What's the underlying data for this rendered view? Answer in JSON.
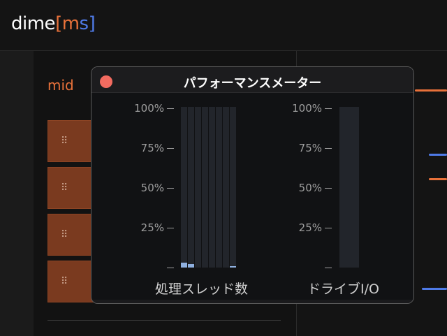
{
  "app": {
    "logo_base": "dime",
    "logo_bracket_open": "[",
    "logo_m": "m",
    "logo_s": "s",
    "logo_bracket_close": "]"
  },
  "main": {
    "section_label": "mid",
    "pad_grip": "⠿"
  },
  "modal": {
    "title": "パフォーマンスメーター",
    "thread_meter": {
      "label": "処理スレッド数",
      "ticks": [
        "100%",
        "75%",
        "50%",
        "25%"
      ],
      "levels": [
        0.03,
        0.02,
        0,
        0,
        0,
        0,
        0,
        0.01
      ]
    },
    "drive_meter": {
      "label": "ドライブI/O",
      "ticks": [
        "100%",
        "75%",
        "50%",
        "25%"
      ],
      "level": 0
    }
  },
  "colors": {
    "accent": "#e8713a",
    "blue": "#4f7be8",
    "pad": "#7a3a1f",
    "bar_fill": "#8fb0e0",
    "close": "#f26b60"
  }
}
